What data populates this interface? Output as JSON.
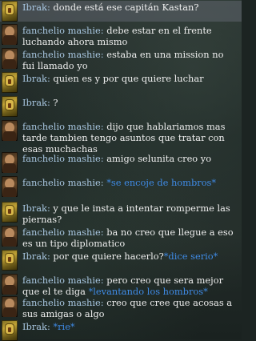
{
  "messages": [
    {
      "speaker": "Ibrak",
      "portrait": "ibrak-portrait",
      "parts": [
        {
          "t": "text",
          "v": "donde está ese capitán Kastan?"
        }
      ],
      "highlight": true
    },
    {
      "speaker": "fanchelio mashie",
      "portrait": "fanchelio-portrait",
      "parts": [
        {
          "t": "text",
          "v": "debe estar en el frente luchando ahora mismo"
        }
      ]
    },
    {
      "speaker": "fanchelio mashie",
      "portrait": "fanchelio-portrait",
      "parts": [
        {
          "t": "text",
          "v": "estaba en una mission no fui llamado yo"
        }
      ]
    },
    {
      "speaker": "Ibrak",
      "portrait": "ibrak-portrait",
      "parts": [
        {
          "t": "text",
          "v": "quien es y por que quiere luchar"
        }
      ]
    },
    {
      "speaker": "Ibrak",
      "portrait": "ibrak-portrait",
      "parts": [
        {
          "t": "text",
          "v": "?"
        }
      ]
    },
    {
      "speaker": "fanchelio mashie",
      "portrait": "fanchelio-portrait",
      "parts": [
        {
          "t": "text",
          "v": "dijo que hablariamos mas tarde tambien tengo asuntos que tratar con esas muchachas"
        }
      ]
    },
    {
      "speaker": "fanchelio mashie",
      "portrait": "fanchelio-portrait",
      "parts": [
        {
          "t": "text",
          "v": "amigo selunita creo yo"
        }
      ]
    },
    {
      "speaker": "fanchelio mashie",
      "portrait": "fanchelio-portrait",
      "parts": [
        {
          "t": "emote",
          "v": "*se encoje de hombros*"
        }
      ]
    },
    {
      "speaker": "Ibrak",
      "portrait": "ibrak-portrait",
      "parts": [
        {
          "t": "text",
          "v": "y que le insta a intentar romperme las piernas?"
        }
      ]
    },
    {
      "speaker": "fanchelio mashie",
      "portrait": "fanchelio-portrait",
      "parts": [
        {
          "t": "text",
          "v": "ba no creo que llegue a eso es un tipo diplomatico"
        }
      ]
    },
    {
      "speaker": "Ibrak",
      "portrait": "ibrak-portrait",
      "parts": [
        {
          "t": "text",
          "v": "por que quiere hacerlo?"
        },
        {
          "t": "emote",
          "v": "*dice serio*"
        }
      ]
    },
    {
      "speaker": "fanchelio mashie",
      "portrait": "fanchelio-portrait",
      "parts": [
        {
          "t": "text",
          "v": "pero creo que sera mejor que  el te diga "
        },
        {
          "t": "emote",
          "v": "*levantando los hombros*"
        }
      ]
    },
    {
      "speaker": "fanchelio mashie",
      "portrait": "fanchelio-portrait",
      "parts": [
        {
          "t": "text",
          "v": "creo que cree que acosas a sus amigas o algo"
        }
      ]
    },
    {
      "speaker": "Ibrak",
      "portrait": "ibrak-portrait",
      "parts": [
        {
          "t": "emote",
          "v": "*rie*"
        }
      ]
    }
  ],
  "speaker_suffix": ":",
  "colors": {
    "speaker": "#a8c6e0",
    "text": "#efefef",
    "emote": "#3f8be6",
    "highlight": "#5f646e"
  }
}
